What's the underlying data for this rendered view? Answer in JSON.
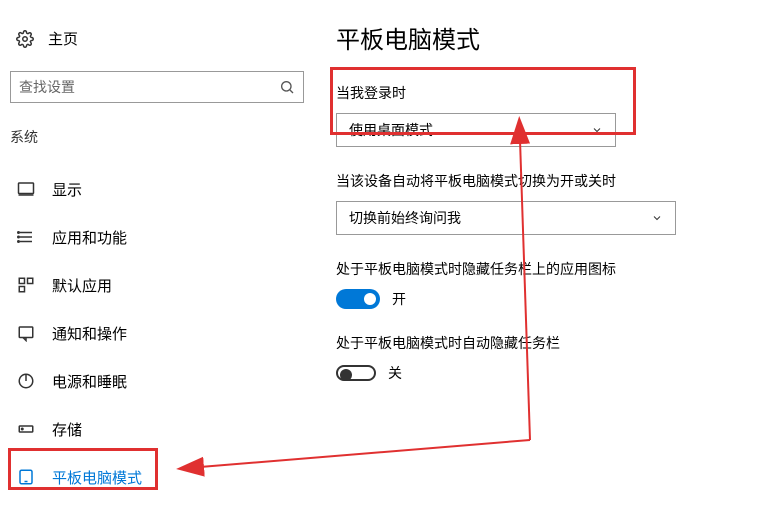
{
  "home": {
    "label": "主页"
  },
  "search": {
    "placeholder": "查找设置"
  },
  "section": {
    "label": "系统"
  },
  "nav": [
    {
      "label": "显示"
    },
    {
      "label": "应用和功能"
    },
    {
      "label": "默认应用"
    },
    {
      "label": "通知和操作"
    },
    {
      "label": "电源和睡眠"
    },
    {
      "label": "存储"
    },
    {
      "label": "平板电脑模式"
    }
  ],
  "page": {
    "title": "平板电脑模式"
  },
  "setting1": {
    "label": "当我登录时",
    "value": "使用桌面模式"
  },
  "setting2": {
    "label": "当该设备自动将平板电脑模式切换为开或关时",
    "value": "切换前始终询问我"
  },
  "setting3": {
    "label": "处于平板电脑模式时隐藏任务栏上的应用图标",
    "state": "开"
  },
  "setting4": {
    "label": "处于平板电脑模式时自动隐藏任务栏",
    "state": "关"
  }
}
